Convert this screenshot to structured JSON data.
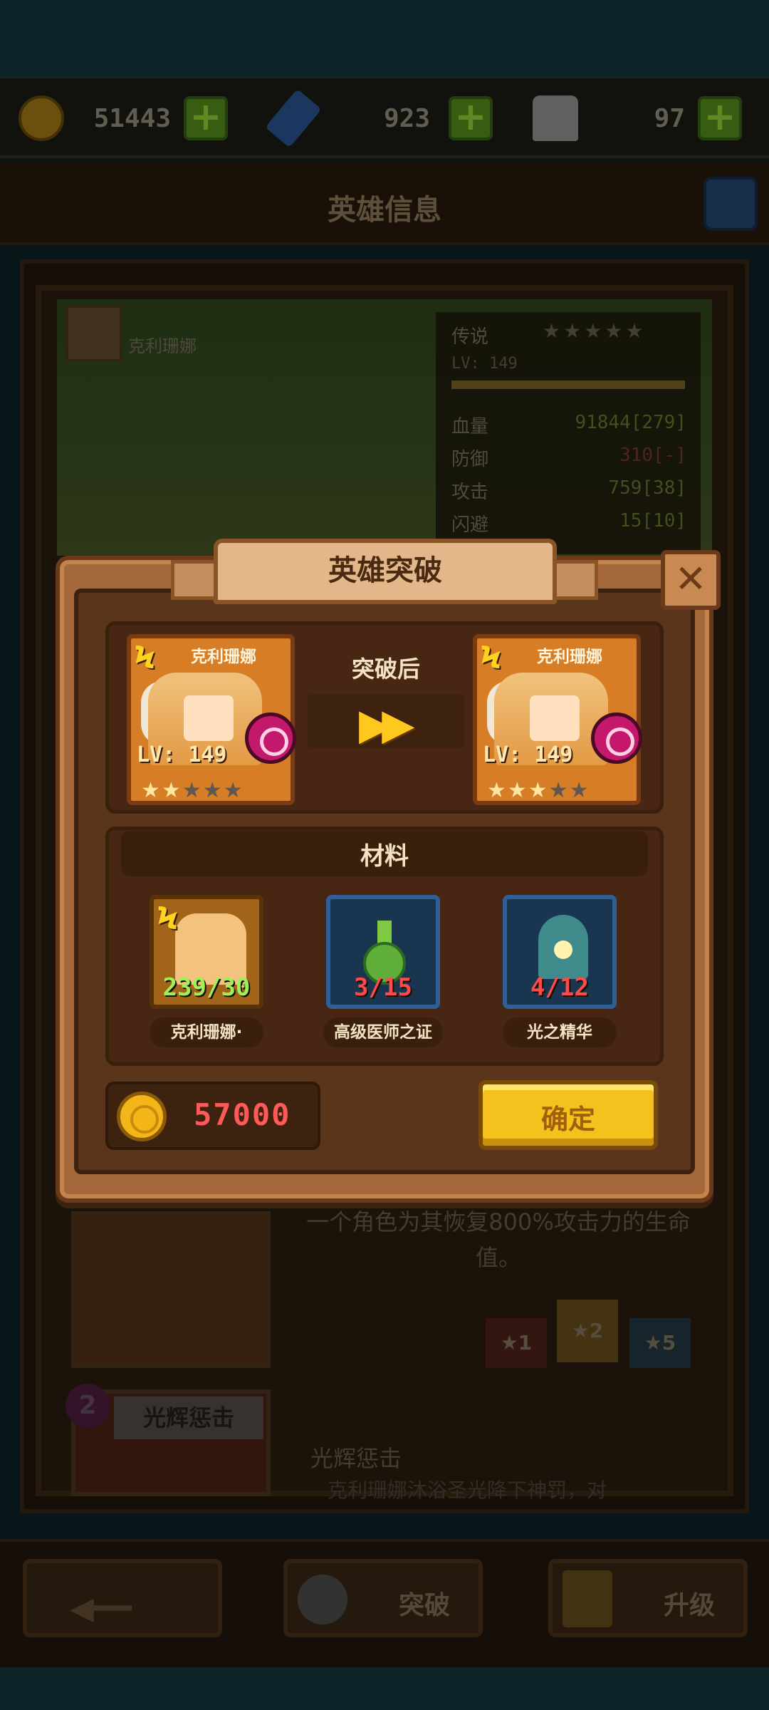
{
  "currencies": [
    {
      "icon": "gold-coin-icon",
      "value": "51443"
    },
    {
      "icon": "blue-gem-icon",
      "value": "923"
    },
    {
      "icon": "bag-icon",
      "value": "97"
    }
  ],
  "screen_title": "英雄信息",
  "hero": {
    "name": "克利珊娜",
    "rarity": "传说",
    "stars_display": "★★★★★",
    "level": "LV: 149",
    "stats": [
      {
        "label": "血量",
        "value": "91844[279]"
      },
      {
        "label": "防御",
        "value": "310[-]"
      },
      {
        "label": "攻击",
        "value": "759[38]"
      },
      {
        "label": "闪避",
        "value": "15[10]"
      }
    ]
  },
  "background_skill": {
    "description": "一个角色为其恢复800%攻击力的生命值。",
    "tiers": [
      "★1",
      "★2",
      "★5"
    ],
    "skill2_number": "2",
    "skill2_title": "光辉惩击",
    "skill2_name": "光辉惩击",
    "skill2_text": "克利珊娜沐浴圣光降下神罚，对"
  },
  "dialog": {
    "title": "英雄突破",
    "close_symbol": "✕",
    "after_label": "突破后",
    "before_card": {
      "name": "克利珊娜",
      "level": "LV: 149",
      "stars_filled": 2,
      "stars_total": 5
    },
    "after_card": {
      "name": "克利珊娜",
      "level": "LV: 149",
      "stars_filled": 3,
      "stars_total": 5
    },
    "materials_title": "材料",
    "materials": [
      {
        "name": "克利珊娜·",
        "count": "239/30",
        "icon": "hero-shard-icon"
      },
      {
        "name": "高级医师之证",
        "count": "3/15",
        "icon": "green-flask-icon"
      },
      {
        "name": "光之精华",
        "count": "4/12",
        "icon": "light-essence-icon"
      }
    ],
    "cost": "57000",
    "confirm_label": "确定"
  },
  "bottom_nav": {
    "breakthrough_label": "突破",
    "upgrade_label": "升级"
  }
}
